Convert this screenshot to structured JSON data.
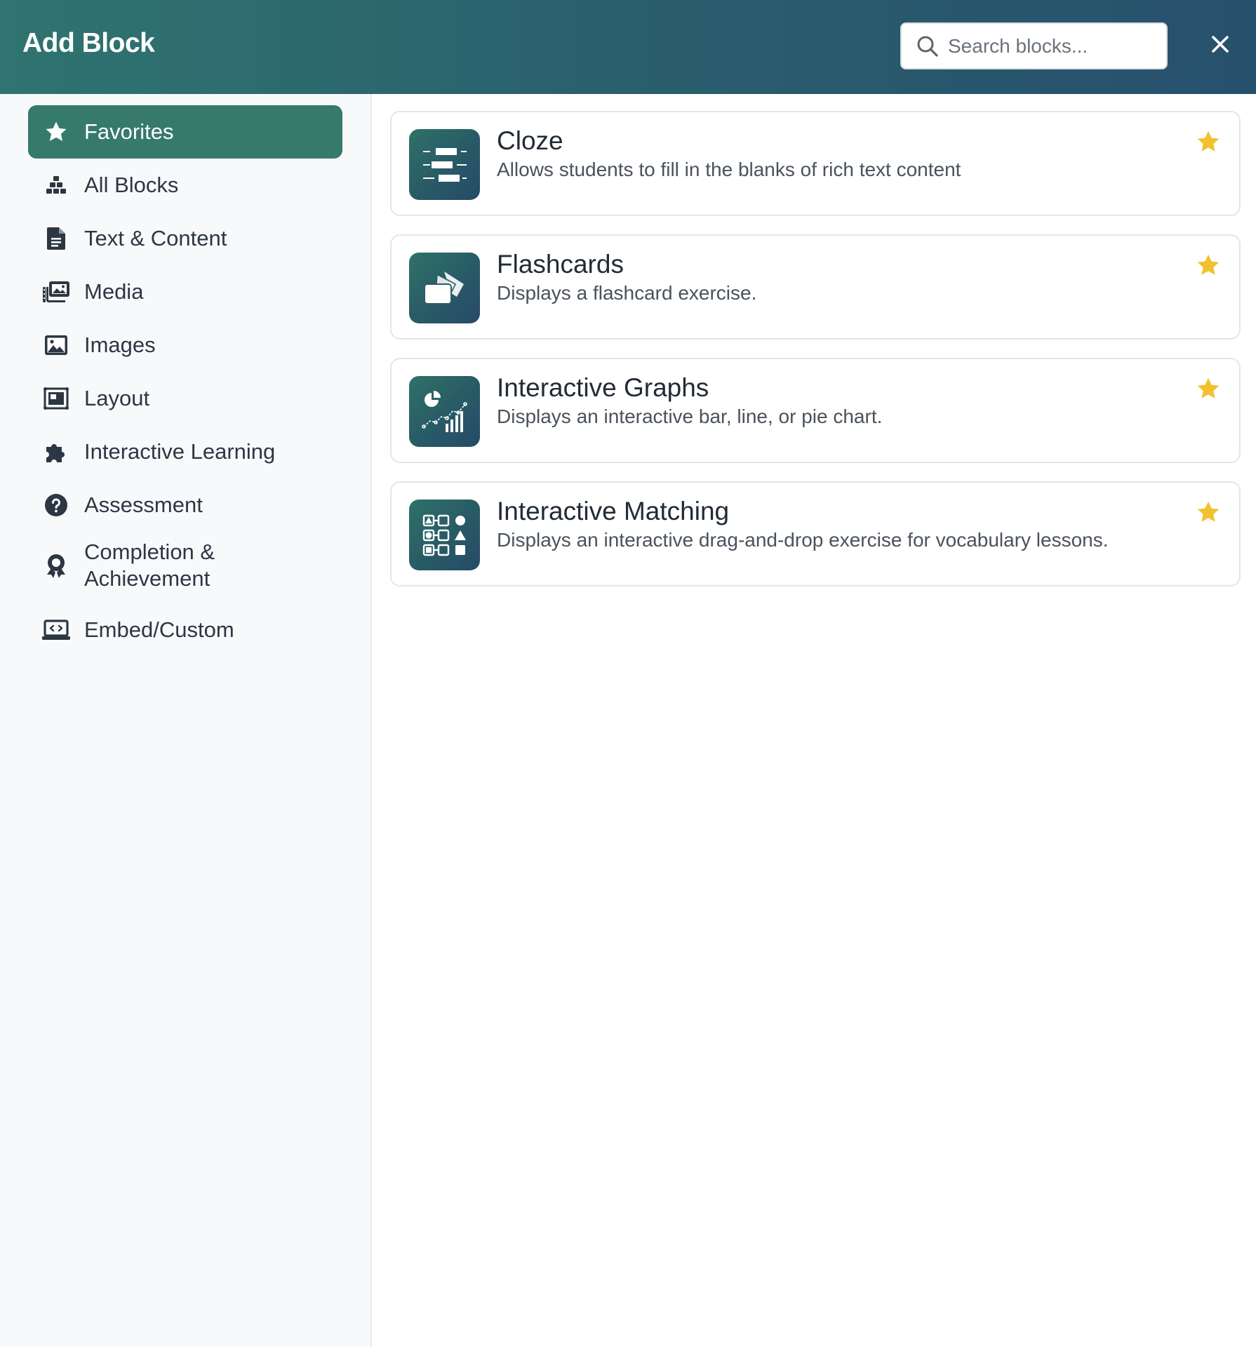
{
  "header": {
    "title": "Add Block",
    "search_placeholder": "Search blocks...",
    "close_label": "×"
  },
  "sidebar": {
    "items": [
      {
        "label": "Favorites",
        "icon": "star-icon",
        "active": true
      },
      {
        "label": "All Blocks",
        "icon": "blocks-icon"
      },
      {
        "label": "Text & Content",
        "icon": "document-icon"
      },
      {
        "label": "Media",
        "icon": "photo-film-icon"
      },
      {
        "label": "Images",
        "icon": "image-icon"
      },
      {
        "label": "Layout",
        "icon": "layout-icon"
      },
      {
        "label": "Interactive Learning",
        "icon": "puzzle-icon"
      },
      {
        "label": "Assessment",
        "icon": "question-circle-icon"
      },
      {
        "label": "Completion & Achievement",
        "line1": "Completion &",
        "line2": "Achievement",
        "icon": "award-icon"
      },
      {
        "label": "Embed/Custom",
        "icon": "laptop-code-icon"
      }
    ]
  },
  "blocks": [
    {
      "title": "Cloze",
      "description": "Allows students to fill in the blanks of rich text content",
      "icon": "cloze-icon",
      "favorite": true
    },
    {
      "title": "Flashcards",
      "description": "Displays a flashcard exercise.",
      "icon": "flashcards-icon",
      "favorite": true
    },
    {
      "title": "Interactive Graphs",
      "description": "Displays an interactive bar, line, or pie chart.",
      "icon": "graphs-icon",
      "favorite": true
    },
    {
      "title": "Interactive Matching",
      "description": "Displays an interactive drag-and-drop exercise for vocabulary lessons.",
      "icon": "matching-icon",
      "favorite": true
    }
  ],
  "colors": {
    "header_start": "#2f7470",
    "header_end": "#27506d",
    "active_nav": "#367a6c",
    "star": "#f2c12e",
    "icon_dark": "#2d3743"
  }
}
